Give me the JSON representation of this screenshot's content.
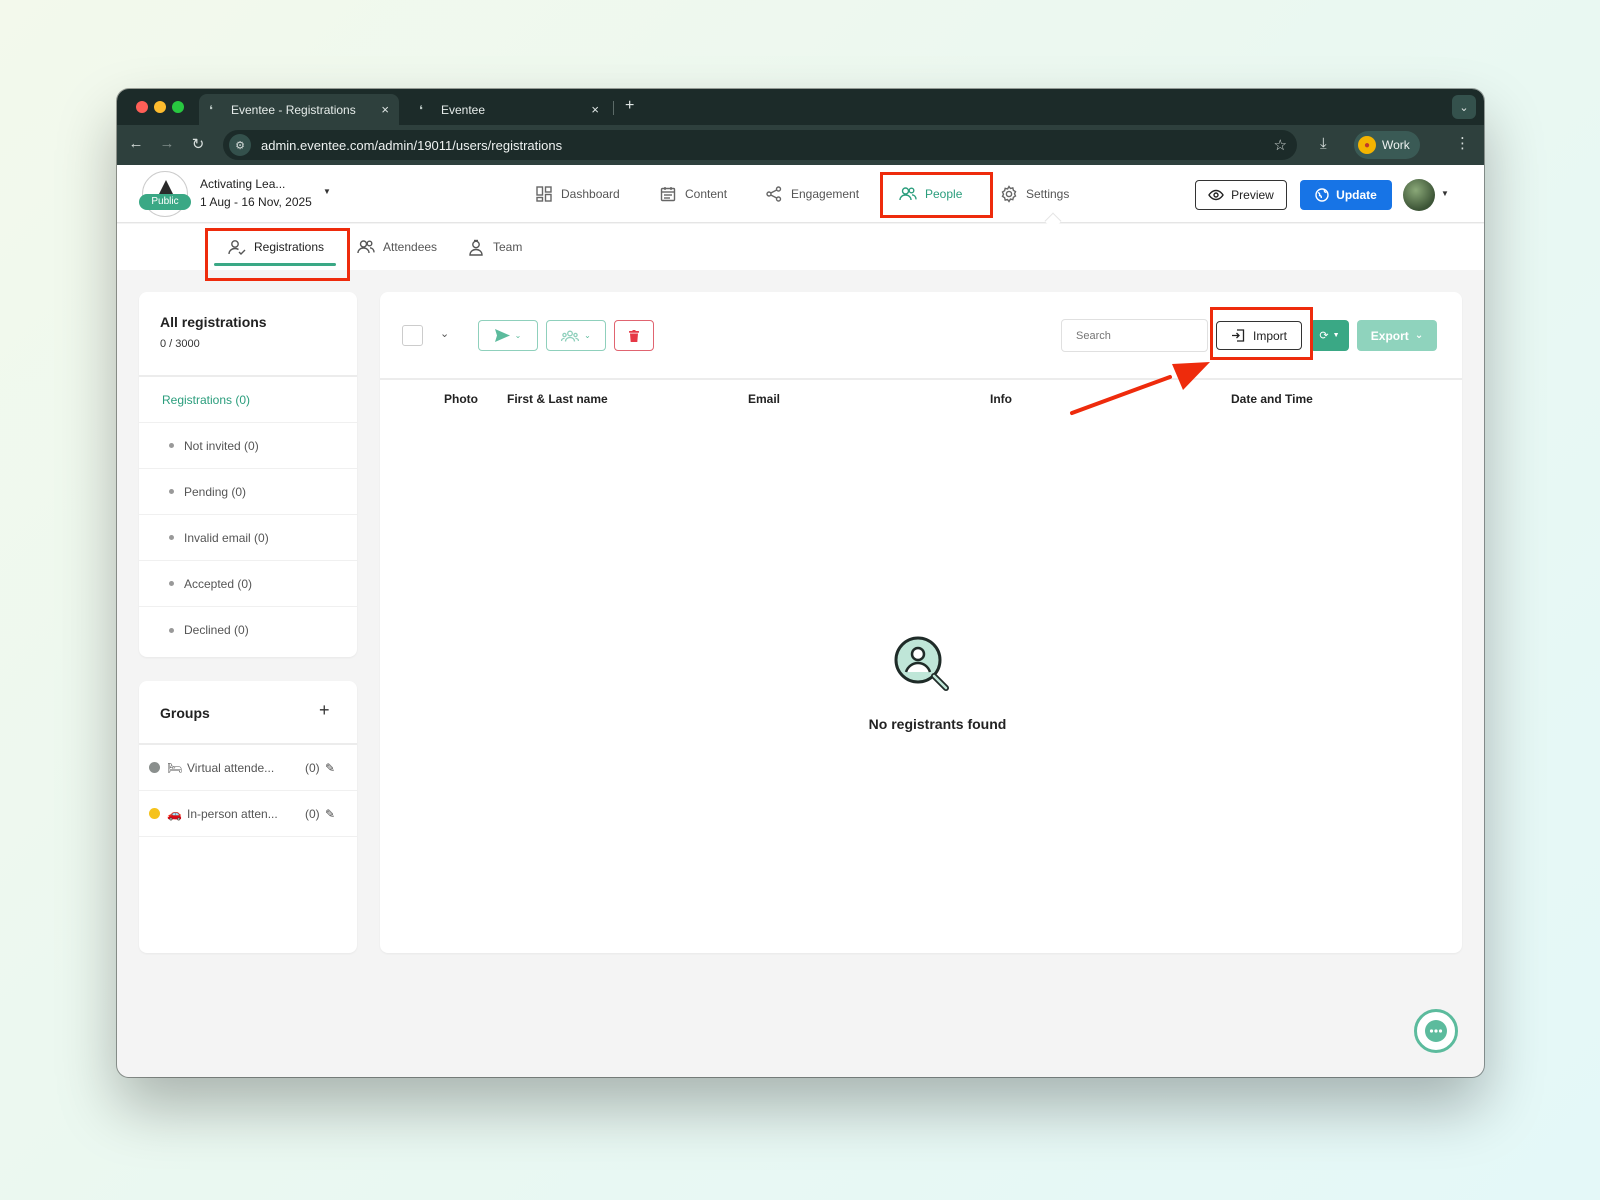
{
  "browser": {
    "tabs": [
      {
        "title": "Eventee - Registrations",
        "close": "×"
      },
      {
        "title": "Eventee",
        "close": "×"
      }
    ],
    "new_tab": "+",
    "url": "admin.eventee.com/admin/19011/users/registrations",
    "profile": "Work"
  },
  "event": {
    "name": "Activating Lea...",
    "dates": "1 Aug - 16 Nov, 2025",
    "status": "Public"
  },
  "nav": {
    "dashboard": "Dashboard",
    "content": "Content",
    "engagement": "Engagement",
    "people": "People",
    "settings": "Settings",
    "active": "People"
  },
  "header": {
    "preview": "Preview",
    "update": "Update"
  },
  "subnav": {
    "registrations": "Registrations",
    "attendees": "Attendees",
    "team": "Team"
  },
  "sidebar": {
    "title": "All registrations",
    "count": "0 / 3000",
    "main_item": "Registrations (0)",
    "items": [
      "Not invited (0)",
      "Pending (0)",
      "Invalid email (0)",
      "Accepted (0)",
      "Declined (0)"
    ]
  },
  "groups": {
    "title": "Groups",
    "add": "+",
    "items": [
      {
        "name": "Virtual attende...",
        "count": "(0)",
        "color": "#8a8f8d",
        "emoji": "🛏"
      },
      {
        "name": "In-person atten...",
        "count": "(0)",
        "color": "#f5c21b",
        "emoji": "🚗"
      }
    ]
  },
  "toolbar": {
    "search_placeholder": "Search",
    "import": "Import",
    "export": "Export"
  },
  "table": {
    "columns": [
      "Photo",
      "First & Last name",
      "Email",
      "Info",
      "Date and Time"
    ]
  },
  "empty_state": "No registrants found",
  "colors": {
    "accent": "#3aa885",
    "update_blue": "#1774e6",
    "delete_red": "#e63946",
    "annotation_red": "#ee2b0c"
  }
}
